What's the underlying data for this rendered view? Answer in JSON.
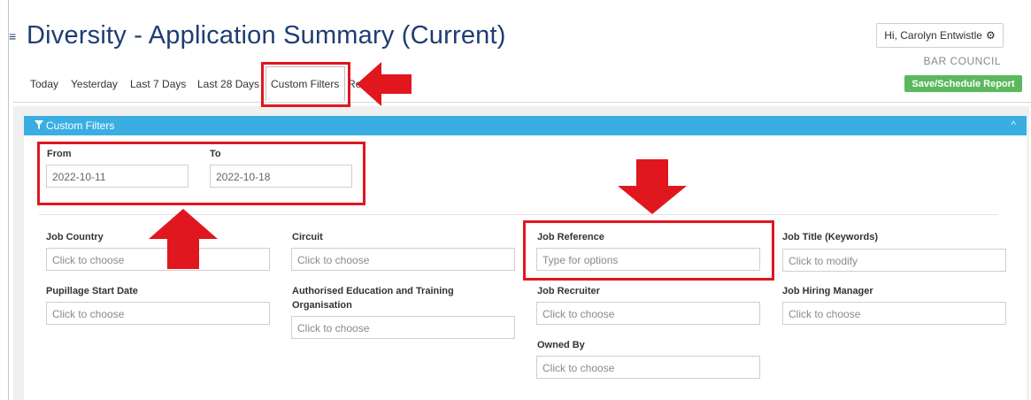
{
  "header": {
    "menu_glyph": "≡",
    "title": "Diversity - Application Summary (Current)",
    "user_greeting": "Hi, Carolyn Entwistle",
    "organisation": "BAR COUNCIL",
    "save_label": "Save/Schedule Report"
  },
  "tabs": [
    {
      "label": "Today"
    },
    {
      "label": "Yesterday"
    },
    {
      "label": "Last 7 Days"
    },
    {
      "label": "Last 28 Days"
    },
    {
      "label": "Custom Filters",
      "active": true
    },
    {
      "label": "Re"
    }
  ],
  "panel": {
    "title": "Custom Filters",
    "collapse_glyph": "^"
  },
  "dates": {
    "from_label": "From",
    "from_value": "2022-10-11",
    "to_label": "To",
    "to_value": "2022-10-18"
  },
  "filters": {
    "job_country": {
      "label": "Job Country",
      "placeholder": "Click to choose"
    },
    "circuit": {
      "label": "Circuit",
      "placeholder": "Click to choose"
    },
    "job_reference": {
      "label": "Job Reference",
      "placeholder": "Type for options"
    },
    "job_title": {
      "label": "Job Title (Keywords)",
      "placeholder": "Click to modify"
    },
    "pupillage_start": {
      "label": "Pupillage Start Date",
      "placeholder": "Click to choose"
    },
    "aeto": {
      "label_line1": "Authorised Education and Training",
      "label_line2": "Organisation",
      "placeholder": "Click to choose"
    },
    "job_recruiter": {
      "label": "Job Recruiter",
      "placeholder": "Click to choose"
    },
    "job_hiring_manager": {
      "label": "Job Hiring Manager",
      "placeholder": "Click to choose"
    },
    "owned_by": {
      "label": "Owned By",
      "placeholder": "Click to choose"
    }
  },
  "colors": {
    "title": "#1f3d73",
    "panel_header": "#3aaee3",
    "save_button": "#5cb85c",
    "annotation": "#e0171f"
  }
}
